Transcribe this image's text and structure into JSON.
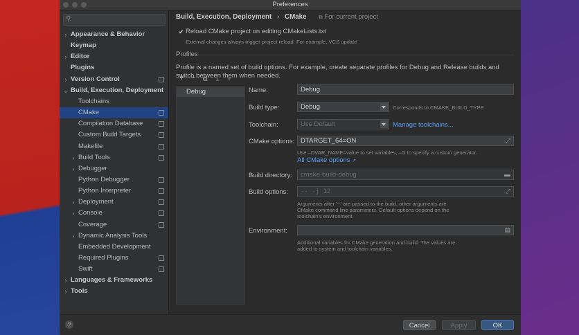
{
  "window": {
    "title": "Preferences"
  },
  "sidebar": {
    "items": [
      {
        "label": "Appearance & Behavior",
        "bold": true,
        "arrow": "›",
        "indent": 0,
        "cfg": false
      },
      {
        "label": "Keymap",
        "bold": true,
        "arrow": "",
        "indent": 0,
        "cfg": false
      },
      {
        "label": "Editor",
        "bold": true,
        "arrow": "›",
        "indent": 0,
        "cfg": false
      },
      {
        "label": "Plugins",
        "bold": true,
        "arrow": "",
        "indent": 0,
        "cfg": false
      },
      {
        "label": "Version Control",
        "bold": true,
        "arrow": "›",
        "indent": 0,
        "cfg": true
      },
      {
        "label": "Build, Execution, Deployment",
        "bold": true,
        "arrow": "⌄",
        "indent": 0,
        "cfg": false
      },
      {
        "label": "Toolchains",
        "bold": false,
        "arrow": "",
        "indent": 1,
        "cfg": false
      },
      {
        "label": "CMake",
        "bold": false,
        "arrow": "",
        "indent": 1,
        "cfg": true,
        "selected": true
      },
      {
        "label": "Compilation Database",
        "bold": false,
        "arrow": "",
        "indent": 1,
        "cfg": true
      },
      {
        "label": "Custom Build Targets",
        "bold": false,
        "arrow": "",
        "indent": 1,
        "cfg": true
      },
      {
        "label": "Makefile",
        "bold": false,
        "arrow": "",
        "indent": 1,
        "cfg": true
      },
      {
        "label": "Build Tools",
        "bold": false,
        "arrow": "›",
        "indent": 1,
        "cfg": true
      },
      {
        "label": "Debugger",
        "bold": false,
        "arrow": "›",
        "indent": 1,
        "cfg": false
      },
      {
        "label": "Python Debugger",
        "bold": false,
        "arrow": "",
        "indent": 1,
        "cfg": true
      },
      {
        "label": "Python Interpreter",
        "bold": false,
        "arrow": "",
        "indent": 1,
        "cfg": true
      },
      {
        "label": "Deployment",
        "bold": false,
        "arrow": "›",
        "indent": 1,
        "cfg": true
      },
      {
        "label": "Console",
        "bold": false,
        "arrow": "›",
        "indent": 1,
        "cfg": true
      },
      {
        "label": "Coverage",
        "bold": false,
        "arrow": "",
        "indent": 1,
        "cfg": true
      },
      {
        "label": "Dynamic Analysis Tools",
        "bold": false,
        "arrow": "›",
        "indent": 1,
        "cfg": false
      },
      {
        "label": "Embedded Development",
        "bold": false,
        "arrow": "",
        "indent": 1,
        "cfg": false
      },
      {
        "label": "Required Plugins",
        "bold": false,
        "arrow": "",
        "indent": 1,
        "cfg": true
      },
      {
        "label": "Swift",
        "bold": false,
        "arrow": "",
        "indent": 1,
        "cfg": true
      },
      {
        "label": "Languages & Frameworks",
        "bold": true,
        "arrow": "›",
        "indent": 0,
        "cfg": false
      },
      {
        "label": "Tools",
        "bold": true,
        "arrow": "›",
        "indent": 0,
        "cfg": false
      }
    ]
  },
  "breadcrumb": {
    "parent": "Build, Execution, Deployment",
    "separator": "›",
    "current": "CMake",
    "scope": "For current project"
  },
  "reload": {
    "label": "Reload CMake project on editing CMakeLists.txt",
    "note": "External changes always trigger project reload. For example, VCS update",
    "checked": true
  },
  "profiles": {
    "section_title": "Profiles",
    "description": "Profile is a named set of build options. For example, create separate profiles for Debug and Release builds and switch between them when needed.",
    "list": [
      "Debug"
    ]
  },
  "form": {
    "name_label": "Name:",
    "name_value": "Debug",
    "build_type_label": "Build type:",
    "build_type_value": "Debug",
    "build_type_hint": "Corresponds to CMAKE_BUILD_TYPE",
    "toolchain_label": "Toolchain:",
    "toolchain_value": "Use Default",
    "toolchain_link": "Manage toolchains...",
    "cmake_options_label": "CMake options:",
    "cmake_options_value": "DTARGET_64=ON",
    "cmake_options_hint": "Use –DVAR_NAME=value to set variables, –G to specify a custom generator.",
    "cmake_options_link": "All CMake options",
    "build_dir_label": "Build directory:",
    "build_dir_value": "cmake-build-debug",
    "build_options_label": "Build options:",
    "build_options_value": "-- -j 12",
    "build_options_hint1": "Arguments after '--' are passed to the build, other arguments are",
    "build_options_hint2": "CMake command line parameters. Default options depend on the",
    "build_options_hint3": "toolchain's environment.",
    "env_label": "Environment:",
    "env_value": "",
    "env_hint1": "Additional variables for CMake generation and build. The values are",
    "env_hint2": "added to system and toolchain variables."
  },
  "buttons": {
    "help": "?",
    "cancel": "Cancel",
    "apply": "Apply",
    "ok": "OK"
  },
  "colors": {
    "accent": "#214283",
    "link": "#589df6",
    "ok_button": "#365880"
  }
}
